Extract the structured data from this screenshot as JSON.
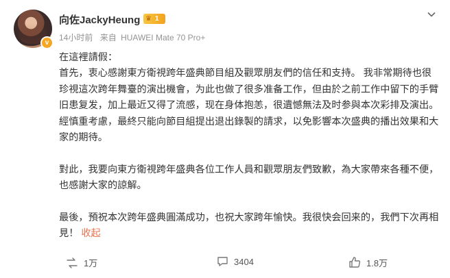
{
  "post": {
    "author": "向佐JackyHeung",
    "level_badge": "1",
    "verified_icon": "v",
    "time": "14小时前",
    "source_prefix": "来自",
    "device": "HUAWEI Mate 70 Pro+",
    "more_icon": "chevron-down-icon",
    "paragraphs": [
      "在這裡請假：",
      "首先，衷心感謝東方衛視跨年盛典節目組及觀眾朋友們的信任和支持。 我非常期待也很珍視這次跨年舞臺的演出機會，为此也做了很多准备工作，但由於之前工作中留下的手臂旧患复发，加上最近又得了流感，现在身体抱恙，很遺憾無法及时参與本次彩排及演出。 經慎重考慮，最終只能向節目組提出退出錄製的請求，以免影響本次盛典的播出效果和大家的期待。",
      "",
      "對此，我要向東方衛視跨年盛典各位工作人員和觀眾朋友們致歉，為大家帶來各種不便，也感謝大家的諒解。",
      "",
      "最後，預祝本次跨年盛典圓滿成功，也祝大家跨年愉快。我很快会回来的，我們下次再相見！"
    ],
    "collapse_label": "收起"
  },
  "actions": {
    "repost_count": "1万",
    "comment_count": "3404",
    "like_count": "1.8万"
  },
  "colors": {
    "link": "#eb7350",
    "meta": "#939393",
    "badge": "#f5a623"
  }
}
